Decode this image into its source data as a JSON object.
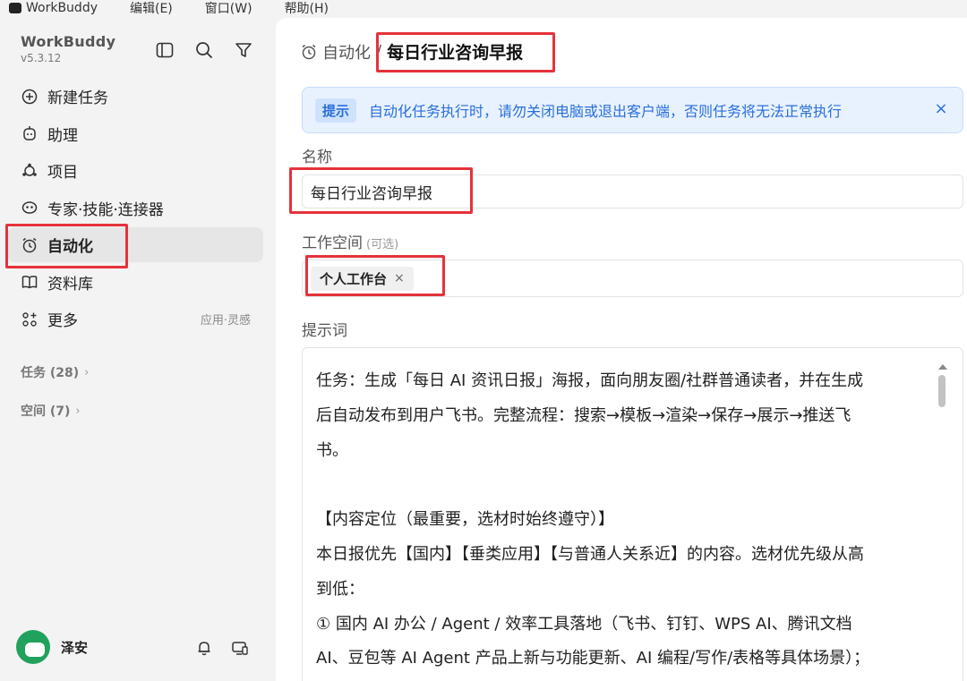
{
  "menubar": {
    "app_name": "WorkBuddy",
    "menus": [
      "编辑(E)",
      "窗口(W)",
      "帮助(H)"
    ]
  },
  "sidebar": {
    "brand": "WorkBuddy",
    "version": "v5.3.12",
    "top_tools": [
      "panel-toggle-icon",
      "search-icon",
      "filter-icon"
    ],
    "nav": [
      {
        "label": "新建任务",
        "icon": "plus-circle-icon"
      },
      {
        "label": "助理",
        "icon": "assistant-icon"
      },
      {
        "label": "项目",
        "icon": "project-icon"
      },
      {
        "label": "专家·技能·连接器",
        "icon": "expert-icon"
      },
      {
        "label": "自动化",
        "icon": "alarm-clock-icon",
        "active": true
      },
      {
        "label": "资料库",
        "icon": "book-icon"
      },
      {
        "label": "更多",
        "icon": "grid-plus-icon",
        "hint": "应用·灵感"
      }
    ],
    "groups": [
      {
        "label": "任务 (28)"
      },
      {
        "label": "空间 (7)"
      }
    ],
    "user": {
      "name": "泽安"
    }
  },
  "main": {
    "breadcrumb": {
      "parent": "自动化",
      "separator": "/",
      "current": "每日行业咨询早报"
    },
    "notice": {
      "tag": "提示",
      "message": "自动化任务执行时，请勿关闭电脑或退出客户端，否则任务将无法正常执行",
      "close": "×"
    },
    "name_label": "名称",
    "name_value": "每日行业咨询早报",
    "workspace_label": "工作空间",
    "workspace_optional": "(可选)",
    "workspace_chip": "个人工作台",
    "workspace_chip_remove": "×",
    "prompt_label": "提示词",
    "prompt_lines": [
      "任务：生成「每日 AI 资讯日报」海报，面向朋友圈/社群普通读者，并在生成",
      "后自动发布到用户飞书。完整流程：搜索→模板→渲染→保存→展示→推送飞",
      "书。",
      "",
      "【内容定位（最重要，选材时始终遵守）】",
      "本日报优先【国内】【垂类应用】【与普通人关系近】的内容。选材优先级从高",
      "到低：",
      "① 国内 AI 办公 / Agent / 效率工具落地（飞书、钉钉、WPS AI、腾讯文档",
      "AI、豆包等 AI Agent 产品上新与功能更新、AI 编程/写作/表格等具体场景）；"
    ]
  },
  "colors": {
    "accent_blue": "#2a6fdb",
    "highlight_red": "#e5323b",
    "avatar_green": "#20a25c"
  }
}
